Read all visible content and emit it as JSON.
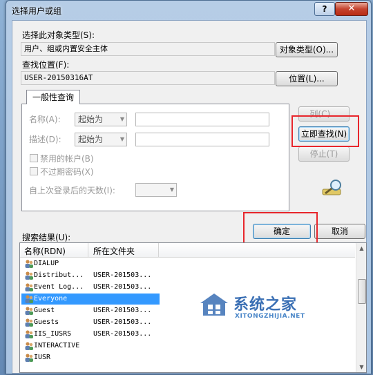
{
  "window": {
    "title": "选择用户或组",
    "help_label": "?",
    "close_label": "✕"
  },
  "object_type": {
    "label": "选择此对象类型(S):",
    "value": "用户、组或内置安全主体",
    "button": "对象类型(O)..."
  },
  "location": {
    "label": "查找位置(F):",
    "value": "USER-20150316AT",
    "button": "位置(L)..."
  },
  "query": {
    "tab_label": "一般性查询",
    "name_label": "名称(A):",
    "name_mode": "起始为",
    "desc_label": "描述(D):",
    "desc_mode": "起始为",
    "disabled_accounts": "禁用的帐户(B)",
    "non_expiring_pw": "不过期密码(X)",
    "days_since_logon": "自上次登录后的天数(I):"
  },
  "buttons": {
    "columns": "列(C)...",
    "find_now": "立即查找(N)",
    "stop": "停止(T)",
    "ok": "确定",
    "cancel": "取消"
  },
  "results": {
    "label": "搜索结果(U):",
    "col_name": "名称(RDN)",
    "col_folder": "所在文件夹",
    "rows": [
      {
        "name": "DIALUP",
        "folder": ""
      },
      {
        "name": "Distribut...",
        "folder": "USER-201503..."
      },
      {
        "name": "Event Log...",
        "folder": "USER-201503..."
      },
      {
        "name": "Everyone",
        "folder": ""
      },
      {
        "name": "Guest",
        "folder": "USER-201503..."
      },
      {
        "name": "Guests",
        "folder": "USER-201503..."
      },
      {
        "name": "IIS_IUSRS",
        "folder": "USER-201503..."
      },
      {
        "name": "INTERACTIVE",
        "folder": ""
      },
      {
        "name": "IUSR",
        "folder": ""
      }
    ],
    "selected_index": 3
  },
  "watermark": {
    "brand": "系统之家",
    "url": "XITONGZHIJIA.NET"
  },
  "colors": {
    "highlight": "#e8262c",
    "selection": "#3399ff"
  }
}
